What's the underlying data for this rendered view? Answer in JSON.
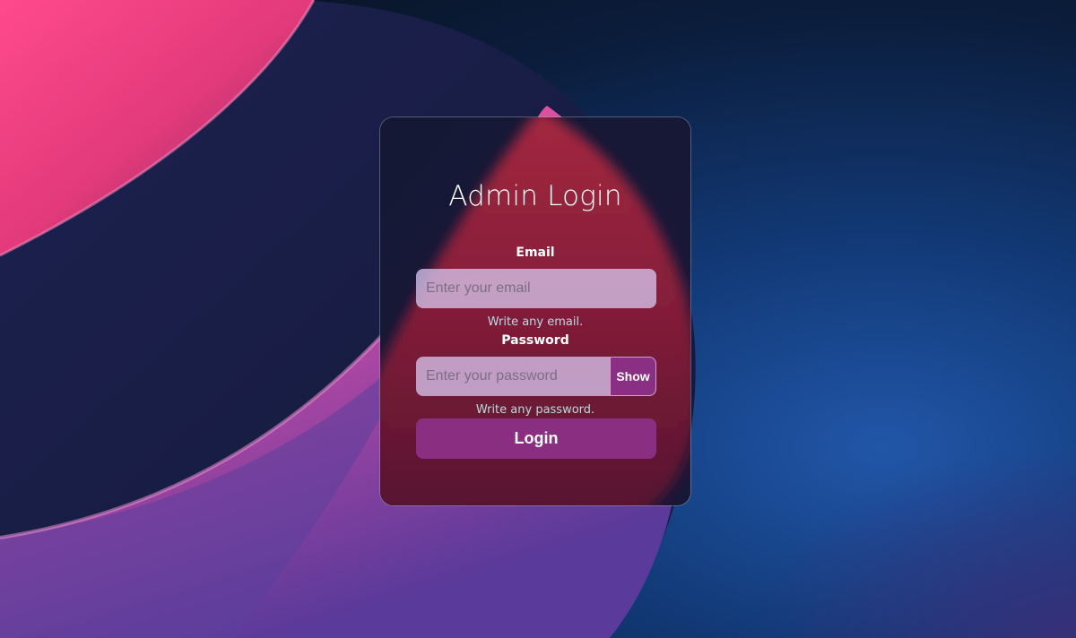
{
  "form": {
    "title": "Admin Login",
    "email": {
      "label": "Email",
      "placeholder": "Enter your email",
      "value": "",
      "hint": "Write any email."
    },
    "password": {
      "label": "Password",
      "placeholder": "Enter your password",
      "value": "",
      "hint": "Write any password.",
      "toggle_label": "Show"
    },
    "submit_label": "Login"
  },
  "colors": {
    "background_dark": "#0c1830",
    "accent_pink": "#f0447e",
    "accent_purple": "#8b2f85",
    "input_fill": "#d6c3ec",
    "hint_text": "#b5dce0"
  }
}
